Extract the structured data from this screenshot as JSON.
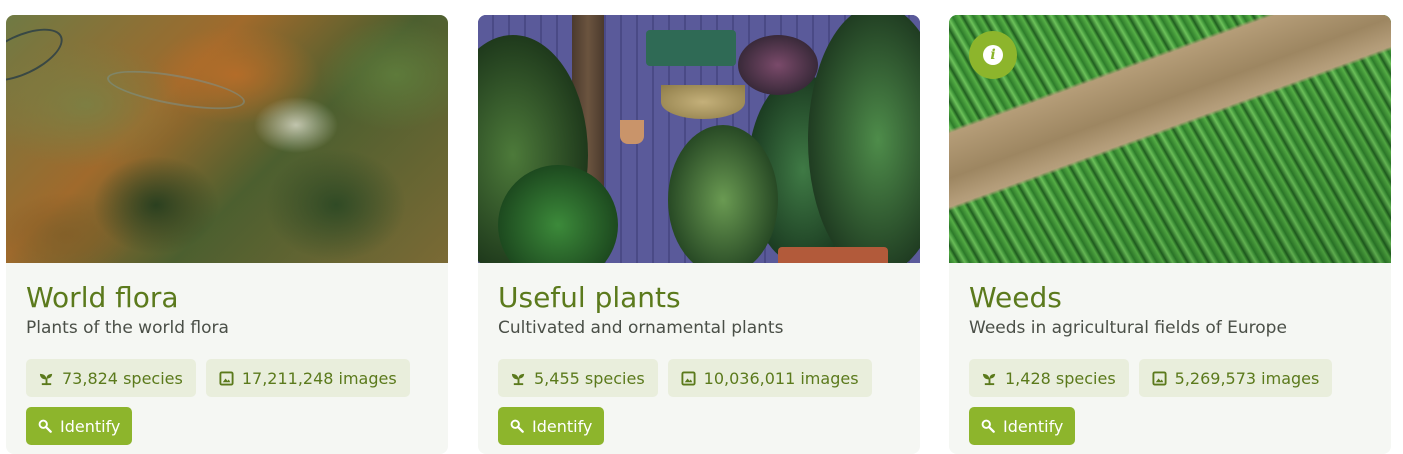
{
  "cards": [
    {
      "title": "World flora",
      "subtitle": "Plants of the world flora",
      "species": "73,824 species",
      "images": "17,211,248 images",
      "action_label": "Identify"
    },
    {
      "title": "Useful plants",
      "subtitle": "Cultivated and ornamental plants",
      "species": "5,455 species",
      "images": "10,036,011 images",
      "action_label": "Identify"
    },
    {
      "title": "Weeds",
      "subtitle": "Weeds in agricultural fields of Europe",
      "species": "1,428 species",
      "images": "5,269,573 images",
      "action_label": "Identify",
      "info_badge": "i"
    }
  ],
  "icons": {
    "species": "sprout-icon",
    "images": "image-icon",
    "identify": "search-icon",
    "info": "info-icon"
  },
  "colors": {
    "accent": "#8db52c",
    "title": "#5b7a1c",
    "chip_bg": "#e9eedc",
    "card_bg": "#f5f7f3"
  }
}
